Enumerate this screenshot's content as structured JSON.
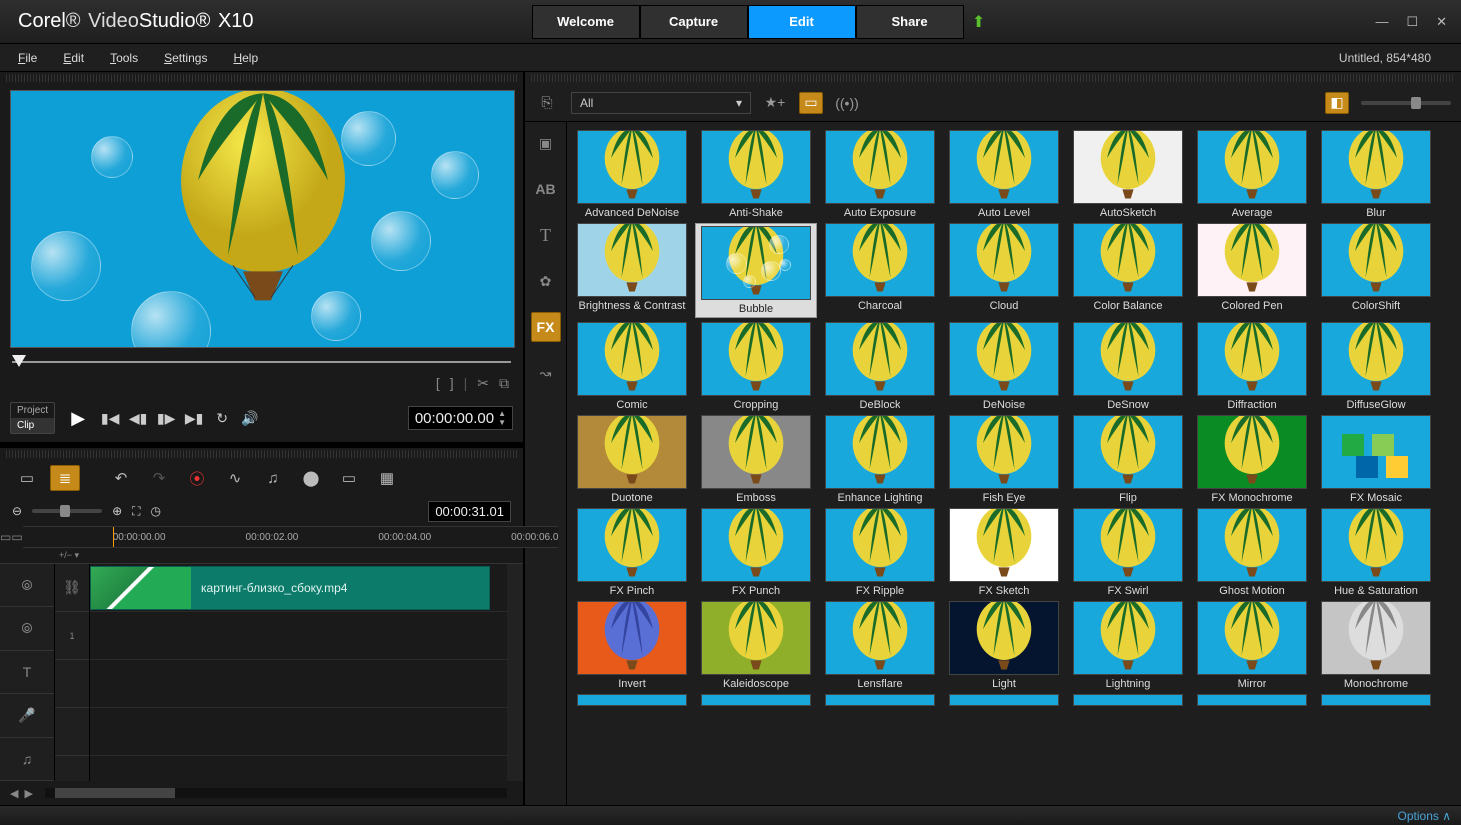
{
  "title": {
    "brand": "Corel",
    "prod1": "Video",
    "prod2": "Studio",
    "ver": "X10"
  },
  "workflow": [
    "Welcome",
    "Capture",
    "Edit",
    "Share"
  ],
  "workflow_active": 2,
  "window": {
    "min": "—",
    "max": "☐",
    "close": "✕"
  },
  "menu": [
    "File",
    "Edit",
    "Tools",
    "Settings",
    "Help"
  ],
  "project_title": "Untitled, 854*480",
  "preview": {
    "bracket_l": "[",
    "bracket_r": "]",
    "scissors": "✂",
    "split": "⧉",
    "pc_project": "Project",
    "pc_clip": "Clip",
    "timecode": "00:00:00.00"
  },
  "timeline": {
    "tc_duration": "00:00:31.01",
    "ruler": [
      "00:00:00.00",
      "00:00:02.00",
      "00:00:04.00",
      "00:00:06.0"
    ],
    "clip_name": "картинг-близко_сбоку.mp4"
  },
  "library": {
    "filter": "All",
    "effects": [
      "Advanced DeNoise",
      "Anti-Shake",
      "Auto Exposure",
      "Auto Level",
      "AutoSketch",
      "Average",
      "Blur",
      "Brightness & Contrast",
      "Bubble",
      "Charcoal",
      "Cloud",
      "Color Balance",
      "Colored Pen",
      "ColorShift",
      "Comic",
      "Cropping",
      "DeBlock",
      "DeNoise",
      "DeSnow",
      "Diffraction",
      "DiffuseGlow",
      "Duotone",
      "Emboss",
      "Enhance Lighting",
      "Fish Eye",
      "Flip",
      "FX Monochrome",
      "FX Mosaic",
      "FX Pinch",
      "FX Punch",
      "FX Ripple",
      "FX Sketch",
      "FX Swirl",
      "Ghost Motion",
      "Hue & Saturation",
      "Invert",
      "Kaleidoscope",
      "Lensflare",
      "Light",
      "Lightning",
      "Mirror",
      "Monochrome"
    ],
    "selected": 8,
    "thumb_bg": {
      "0": "#18a8db",
      "4": "#f0f0f0",
      "5": "#18a8db",
      "7": "#9fd4e8",
      "12": "#fff2f7",
      "21": "#b38a3a",
      "22": "#888",
      "26": "#0a8b24",
      "31": "#fff",
      "35": "#e85a1a",
      "36": "#8fae2a",
      "38": "#051530",
      "41": "#c5c5c5"
    }
  },
  "footer": {
    "options": "Options"
  }
}
